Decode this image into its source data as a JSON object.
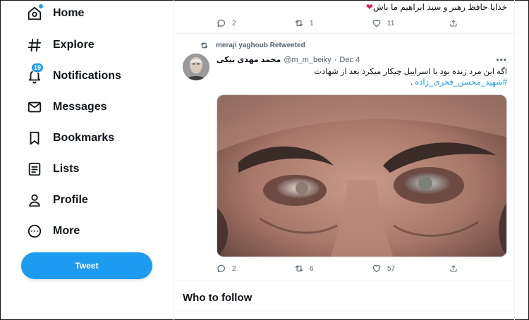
{
  "sidebar": {
    "items": [
      {
        "label": "Home",
        "icon": "home-icon"
      },
      {
        "label": "Explore",
        "icon": "hashtag-icon"
      },
      {
        "label": "Notifications",
        "icon": "bell-icon",
        "badge": "19"
      },
      {
        "label": "Messages",
        "icon": "envelope-icon"
      },
      {
        "label": "Bookmarks",
        "icon": "bookmark-icon"
      },
      {
        "label": "Lists",
        "icon": "list-icon"
      },
      {
        "label": "Profile",
        "icon": "person-icon"
      },
      {
        "label": "More",
        "icon": "more-circle-icon"
      }
    ],
    "tweet_button": "Tweet"
  },
  "previous_tweet": {
    "text": "خدایا حافظ رهبر و سید ابراهیم ما باش",
    "emoji": "❤",
    "replies": "2",
    "retweets": "1",
    "likes": "11"
  },
  "tweet": {
    "retweeted_by": "meraji yaghoub Retweeted",
    "display_name": "محمد مهدی بیکی",
    "handle": "@m_m_beiky",
    "separator": "·",
    "time": "Dec 4",
    "more": "•••",
    "body": "اگه این مرد زنده بود با اسراییل چیکار میکرد بعد از شهادت",
    "hashtag": "#شهید_محسن_فخری_زاده",
    "hashtag_suffix": " .",
    "replies": "2",
    "retweets": "6",
    "likes": "57"
  },
  "who_to_follow": {
    "title": "Who to follow"
  },
  "colors": {
    "accent": "#1d9bf0",
    "text": "#0f1419",
    "muted": "#536471",
    "border": "#eff3f4",
    "heart": "#e0245e"
  }
}
